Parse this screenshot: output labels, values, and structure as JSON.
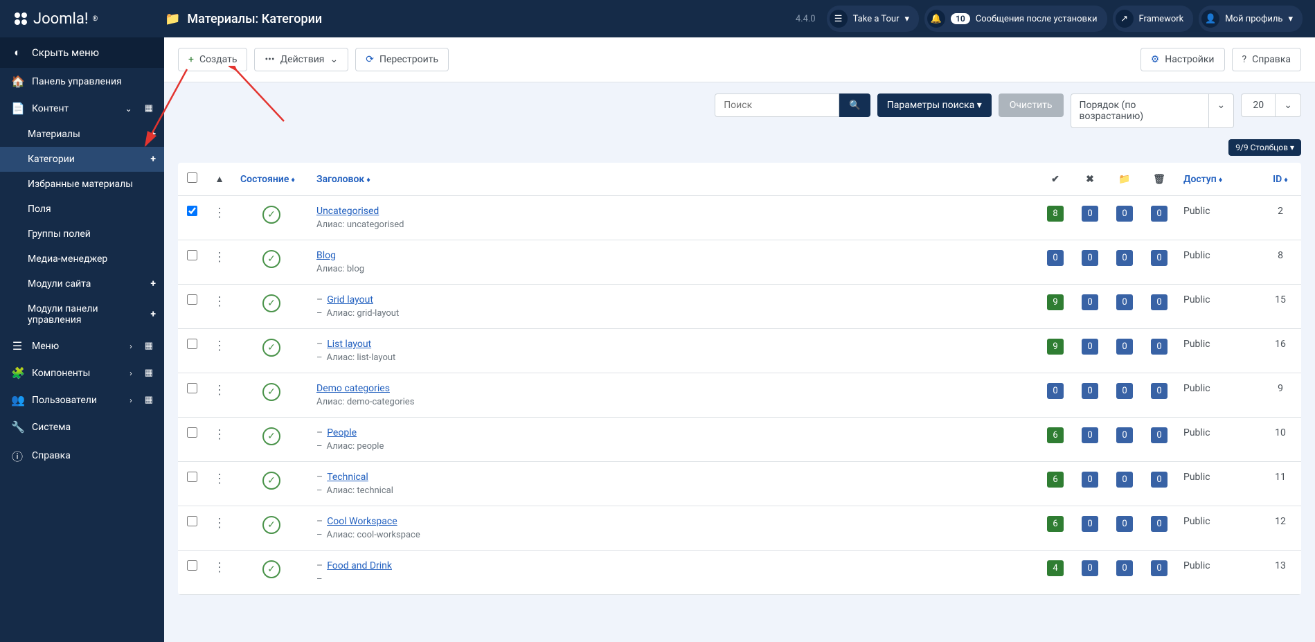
{
  "brand": "Joomla!",
  "page_title": "Материалы: Категории",
  "version": "4.4.0",
  "header": {
    "tour": "Take a Tour",
    "notif_count": "10",
    "notif_text": "Сообщения после установки",
    "framework": "Framework",
    "profile": "Мой профиль"
  },
  "sidebar": {
    "toggle": "Скрыть меню",
    "dashboard": "Панель управления",
    "content": "Контент",
    "articles": "Материалы",
    "categories": "Категории",
    "featured": "Избранные материалы",
    "fields": "Поля",
    "fieldgroups": "Группы полей",
    "media": "Медиа-менеджер",
    "site_modules": "Модули сайта",
    "admin_modules": "Модули панели управления",
    "menus": "Меню",
    "components": "Компоненты",
    "users": "Пользователи",
    "system": "Система",
    "help": "Справка"
  },
  "toolbar": {
    "create": "Создать",
    "actions": "Действия",
    "rebuild": "Перестроить",
    "options": "Настройки",
    "help": "Справка"
  },
  "filters": {
    "search_ph": "Поиск",
    "params": "Параметры поиска",
    "clear": "Очистить",
    "sort": "Порядок (по возрастанию)",
    "limit": "20",
    "columns": "9/9 Столбцов"
  },
  "columns": {
    "status": "Состояние",
    "title": "Заголовок",
    "access": "Доступ",
    "id": "ID"
  },
  "alias_prefix": "Алиас: ",
  "rows": [
    {
      "checked": true,
      "title": "Uncategorised",
      "alias": "uncategorised",
      "level": 0,
      "c1": "8",
      "c1c": "g",
      "c2": "0",
      "c3": "0",
      "c4": "0",
      "access": "Public",
      "id": "2"
    },
    {
      "checked": false,
      "title": "Blog",
      "alias": "blog",
      "level": 0,
      "c1": "0",
      "c1c": "b",
      "c2": "0",
      "c3": "0",
      "c4": "0",
      "access": "Public",
      "id": "8"
    },
    {
      "checked": false,
      "title": "Grid layout",
      "alias": "grid-layout",
      "level": 1,
      "c1": "9",
      "c1c": "g",
      "c2": "0",
      "c3": "0",
      "c4": "0",
      "access": "Public",
      "id": "15"
    },
    {
      "checked": false,
      "title": "List layout",
      "alias": "list-layout",
      "level": 1,
      "c1": "9",
      "c1c": "g",
      "c2": "0",
      "c3": "0",
      "c4": "0",
      "access": "Public",
      "id": "16"
    },
    {
      "checked": false,
      "title": "Demo categories",
      "alias": "demo-categories",
      "level": 0,
      "c1": "0",
      "c1c": "b",
      "c2": "0",
      "c3": "0",
      "c4": "0",
      "access": "Public",
      "id": "9"
    },
    {
      "checked": false,
      "title": "People",
      "alias": "people",
      "level": 1,
      "c1": "6",
      "c1c": "g",
      "c2": "0",
      "c3": "0",
      "c4": "0",
      "access": "Public",
      "id": "10"
    },
    {
      "checked": false,
      "title": "Technical",
      "alias": "technical",
      "level": 1,
      "c1": "6",
      "c1c": "g",
      "c2": "0",
      "c3": "0",
      "c4": "0",
      "access": "Public",
      "id": "11"
    },
    {
      "checked": false,
      "title": "Cool Workspace",
      "alias": "cool-workspace",
      "level": 1,
      "c1": "6",
      "c1c": "g",
      "c2": "0",
      "c3": "0",
      "c4": "0",
      "access": "Public",
      "id": "12"
    },
    {
      "checked": false,
      "title": "Food and Drink",
      "alias": "",
      "level": 1,
      "c1": "4",
      "c1c": "g",
      "c2": "0",
      "c3": "0",
      "c4": "0",
      "access": "Public",
      "id": "13"
    }
  ]
}
